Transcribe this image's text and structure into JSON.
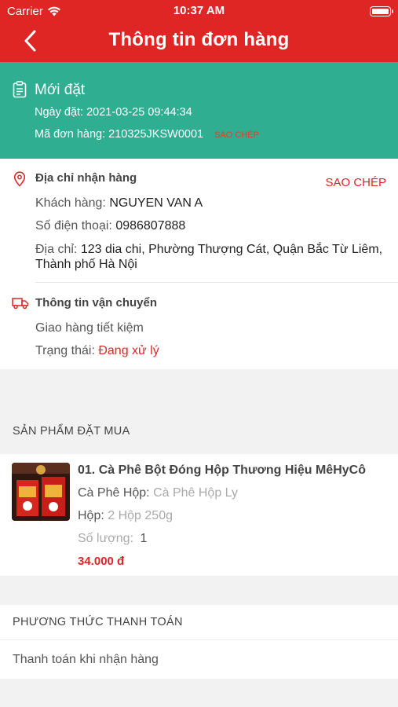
{
  "status_bar": {
    "carrier": "Carrier",
    "time": "10:37 AM"
  },
  "header": {
    "title": "Thông tin đơn hàng"
  },
  "order_status": {
    "status": "Mới đặt",
    "date_label": "Ngày đặt:",
    "date_value": "2021-03-25 09:44:34",
    "code_label": "Mã đơn hàng:",
    "code_value": "210325JKSW0001",
    "copy_label": "SAO CHÉP"
  },
  "address": {
    "title": "Địa chỉ nhận hàng",
    "copy_label": "SAO CHÉP",
    "customer_label": "Khách hàng:",
    "customer_value": "NGUYEN VAN A",
    "phone_label": "Số điện thoại:",
    "phone_value": "0986807888",
    "addr_label": "Địa chỉ:",
    "addr_value_line1": "123 dia chi, Phường Thượng Cát, Quận Bắc Từ Liêm,",
    "addr_value_line2": "Thành phố Hà Nội"
  },
  "shipping": {
    "title": "Thông tin vận chuyển",
    "method": "Giao hàng tiết kiệm",
    "status_label": "Trạng thái:",
    "status_value": "Đang xử lý"
  },
  "products": {
    "section_title": "SẢN PHẨM ĐẶT MUA",
    "items": [
      {
        "name": "01. Cà Phê Bột Đóng Hộp Thương Hiệu MêHyCô",
        "attr1_label": "Cà Phê Hộp:",
        "attr1_value": "Cà Phê Hộp Ly",
        "attr2_label": "Hộp:",
        "attr2_value": "2 Hộp 250g",
        "qty_label": "Số lượng:",
        "qty_value": "1",
        "price": "34.000 đ"
      }
    ]
  },
  "payment": {
    "section_title": "PHƯƠNG THỨC THANH TOÁN",
    "method": "Thanh toán khi nhận hàng"
  },
  "colors": {
    "brand_red": "#e02525",
    "status_green": "#2fae92"
  }
}
